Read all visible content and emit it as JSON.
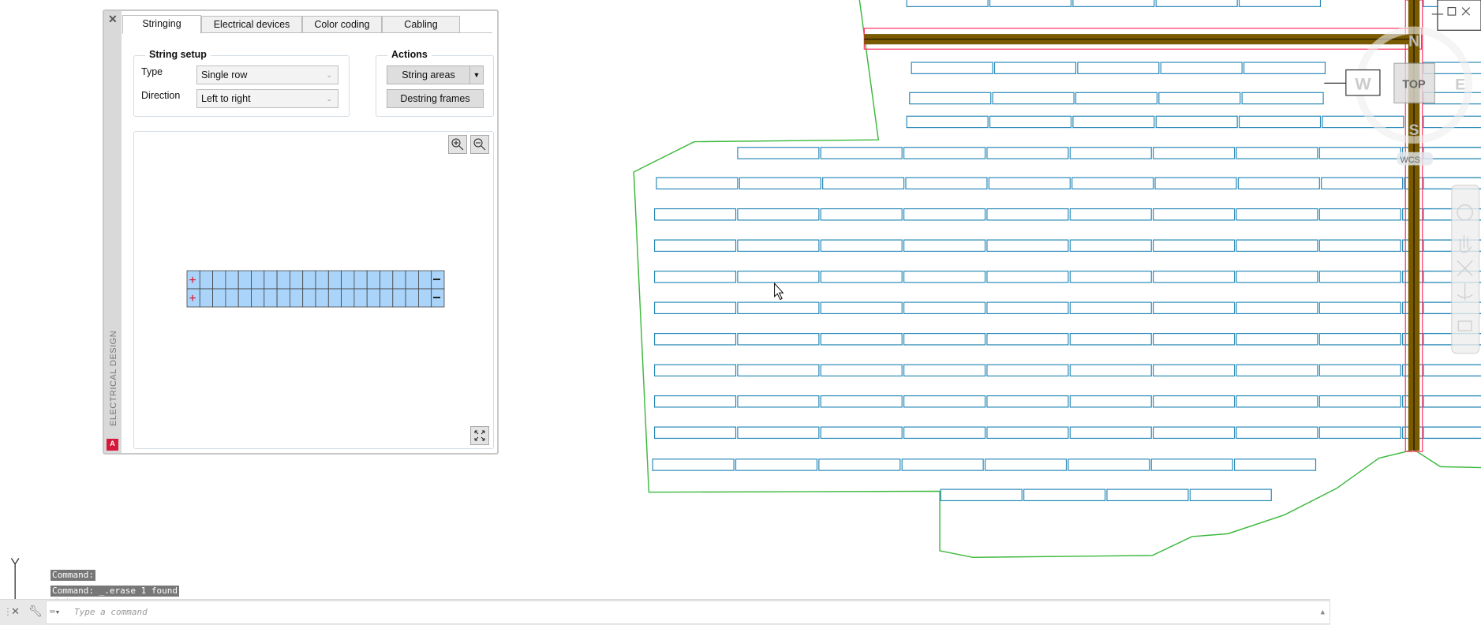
{
  "palette": {
    "side_title": "ELECTRICAL DESIGN",
    "close_icon": "close-icon",
    "logo_text": "A",
    "tabs": [
      {
        "label": "Stringing",
        "active": true
      },
      {
        "label": "Electrical devices",
        "active": false
      },
      {
        "label": "Color coding",
        "active": false
      },
      {
        "label": "Cabling",
        "active": false
      }
    ],
    "string_setup": {
      "title": "String setup",
      "type_label": "Type",
      "type_value": "Single row",
      "direction_label": "Direction",
      "direction_value": "Left to right"
    },
    "actions": {
      "title": "Actions",
      "string_areas": "String areas",
      "destring_frames": "Destring frames"
    },
    "preview": {
      "rows": 2,
      "modules_per_row": 20,
      "positive_symbol": "+",
      "negative_symbol": "—"
    }
  },
  "viewcube": {
    "north": "N",
    "south": "S",
    "east": "E",
    "west": "W",
    "top": "TOP",
    "ucs": "WCS"
  },
  "ucs_icon": {
    "y": "Y"
  },
  "command": {
    "history": [
      "Command:",
      "Command:  _.erase 1 found"
    ],
    "placeholder": "Type a command"
  },
  "colors": {
    "panel_outline": "#2a8ab8",
    "boundary": "#3cb83c",
    "road": "#7a5a00",
    "road_edge": "#ff3060"
  }
}
